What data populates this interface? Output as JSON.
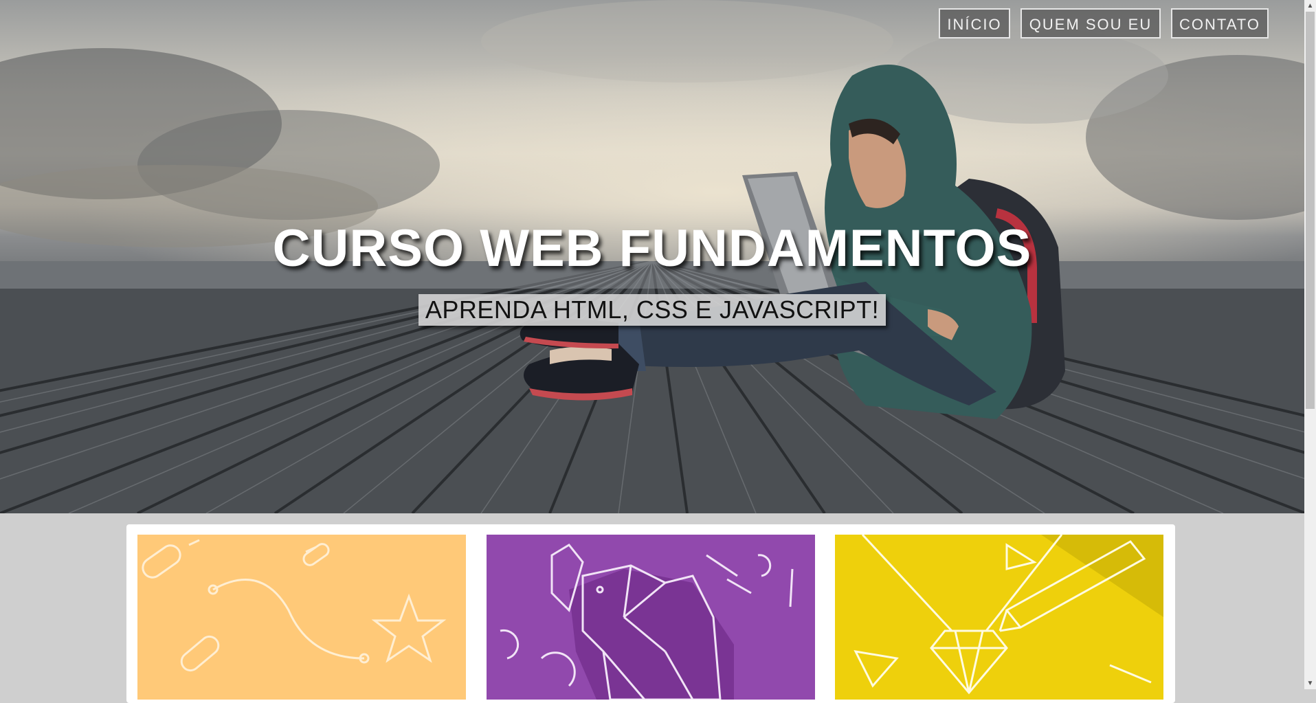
{
  "nav": {
    "items": [
      {
        "label": "INÍCIO"
      },
      {
        "label": "QUEM SOU EU"
      },
      {
        "label": "CONTATO"
      }
    ]
  },
  "hero": {
    "title": "CURSO WEB FUNDAMENTOS",
    "subtitle": "APRENDA HTML, CSS E JAVASCRIPT!"
  },
  "cards": [
    {
      "illustration": "bezier-curve-star-icon",
      "color": "#ffc978"
    },
    {
      "illustration": "origami-elephant-icon",
      "color": "#9149ad"
    },
    {
      "illustration": "diamond-pencil-icon",
      "color": "#eed00c"
    }
  ],
  "colors": {
    "nav_bg": "#5a5a5a",
    "page_bg": "#cfcfcf"
  }
}
